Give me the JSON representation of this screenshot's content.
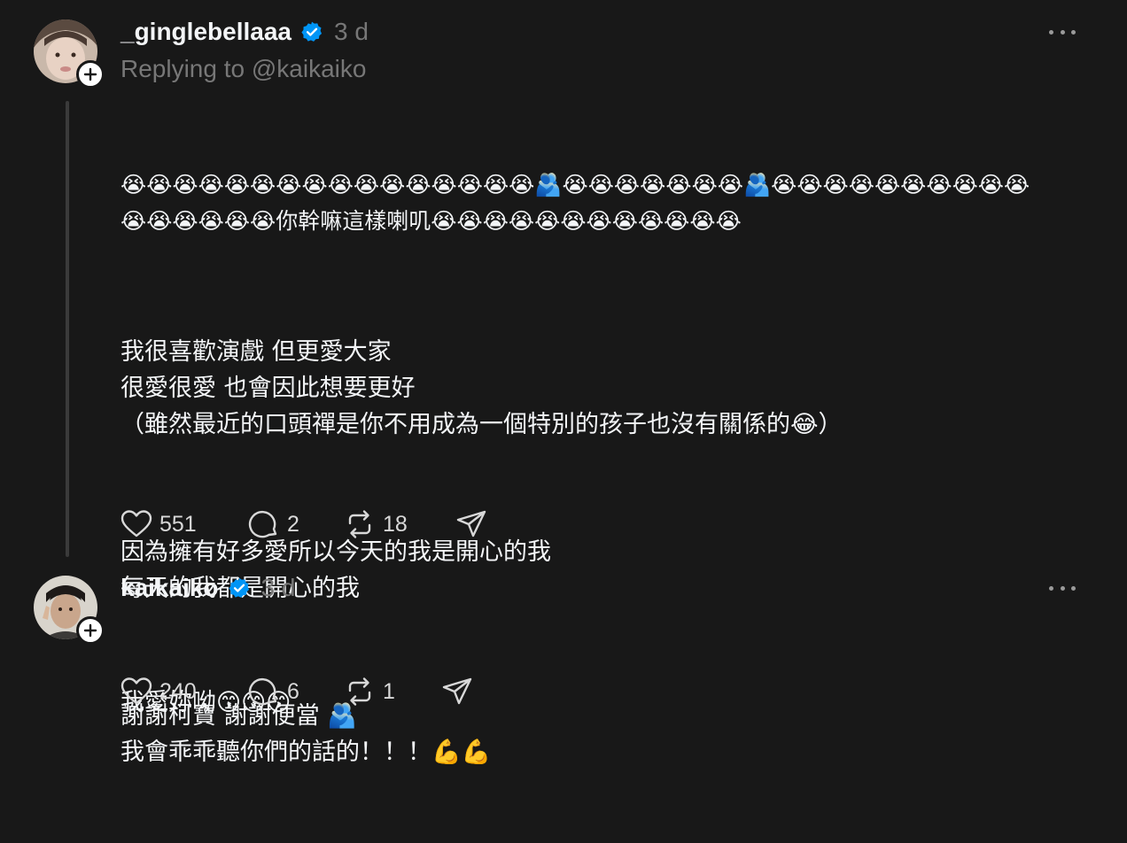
{
  "posts": [
    {
      "username": "_ginglebellaaa",
      "timestamp": "3 d",
      "replying_to": "Replying to @kaikaiko",
      "paragraphs": [
        "😭😭😭😭😭😭😭😭😭😭😭😭😭😭😭😭🫂😭😭😭😭😭😭😭🫂😭😭😭😭😭😭😭😭😭😭\n😭😭😭😭😭😭你幹嘛這樣喇叽😭😭😭😭😭😭😭😭😭😭😭😭",
        "我很喜歡演戲 但更愛大家\n很愛很愛 也會因此想要更好\n（雖然最近的口頭禪是你不用成為一個特別的孩子也沒有關係的😂）",
        "因為擁有好多愛所以今天的我是開心的我\n每天的我都是開心的我",
        "謝謝柯寶 謝謝便當 🫂\n我會乖乖聽你們的話的！！！💪💪"
      ],
      "likes": "551",
      "replies": "2",
      "reposts": "18"
    },
    {
      "username": "kaikaiko",
      "timestamp": "3 d",
      "paragraphs": [
        "我愛妳呦😙😙😙"
      ],
      "likes": "240",
      "replies": "6",
      "reposts": "1"
    }
  ],
  "icons": {
    "verified": "verified-badge-icon",
    "more": "more-options-icon",
    "follow": "plus-icon",
    "like": "heart-icon",
    "reply": "comment-bubble-icon",
    "repost": "repost-icon",
    "share": "send-icon"
  },
  "colors": {
    "background": "#181818",
    "text": "#f3f5f7",
    "muted": "#777777",
    "verified": "#0095f6",
    "thread_line": "#3a3a3a"
  }
}
